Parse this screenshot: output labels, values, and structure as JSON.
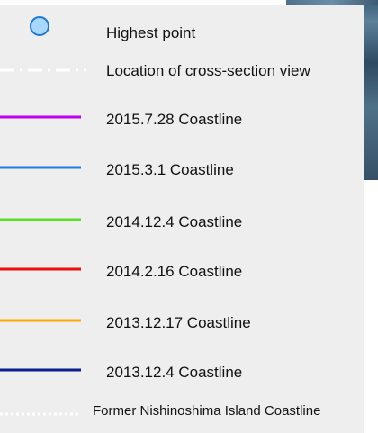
{
  "legend": {
    "items": [
      {
        "id": "highest-point",
        "label": "Highest point",
        "symbol": "circle",
        "fill": "#a9d8ff",
        "stroke": "#1f78d1"
      },
      {
        "id": "cross-section",
        "label": "Location of cross-section view",
        "symbol": "dash-dot",
        "color": "#ffffff"
      },
      {
        "id": "coast-2015-07-28",
        "label": "2015.7.28 Coastline",
        "symbol": "line",
        "color": "#c000f0"
      },
      {
        "id": "coast-2015-03-01",
        "label": "2015.3.1 Coastline",
        "symbol": "line",
        "color": "#1e7cf0"
      },
      {
        "id": "coast-2014-12-04",
        "label": "2014.12.4 Coastline",
        "symbol": "line",
        "color": "#55e020"
      },
      {
        "id": "coast-2014-02-16",
        "label": "2014.2.16 Coastline",
        "symbol": "line",
        "color": "#ee1010"
      },
      {
        "id": "coast-2013-12-17",
        "label": "2013.12.17 Coastline",
        "symbol": "line",
        "color": "#ffaa00"
      },
      {
        "id": "coast-2013-12-04",
        "label": "2013.12.4 Coastline",
        "symbol": "line",
        "color": "#0a1f8f"
      },
      {
        "id": "former-nishinoshima",
        "label": "Former Nishinoshima Island Coastline",
        "symbol": "dotted",
        "color": "#ffffff"
      }
    ]
  }
}
